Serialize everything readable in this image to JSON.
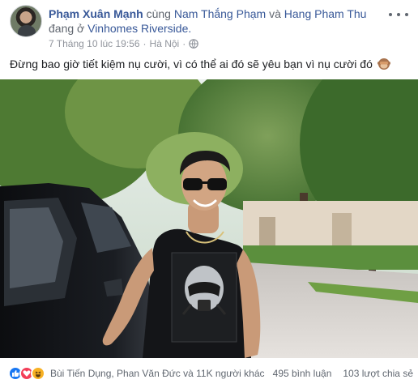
{
  "post": {
    "author": "Phạm Xuân Mạnh",
    "with_text": "cùng",
    "tag_1": "Nam Thắng Phạm",
    "and_text": "và",
    "tag_2": "Hang Pham Thu",
    "location_prefix": "đang ở",
    "location": "Vinhomes Riverside.",
    "timestamp": "7 Tháng 10 lúc 19:56",
    "separator": "·",
    "city": "Hà Nội",
    "privacy_icon": "globe-icon",
    "caption": "Đừng bao giờ tiết kiệm nụ cười, vì có thể ai đó sẽ yêu bạn vì nụ cười đó",
    "caption_emoji": "see-no-evil-monkey-icon"
  },
  "footer": {
    "reaction_icons": [
      "like-icon",
      "love-icon",
      "haha-icon"
    ],
    "reaction_names": "Bùi Tiến Dụng, Phan Văn Đức và 11K người khác",
    "comments": "495 bình luận",
    "shares": "103 lượt chia sẻ"
  },
  "colors": {
    "link": "#385898",
    "meta": "#90949c",
    "like": "#1877f2",
    "love": "#f33e58",
    "haha": "#f7b125"
  }
}
